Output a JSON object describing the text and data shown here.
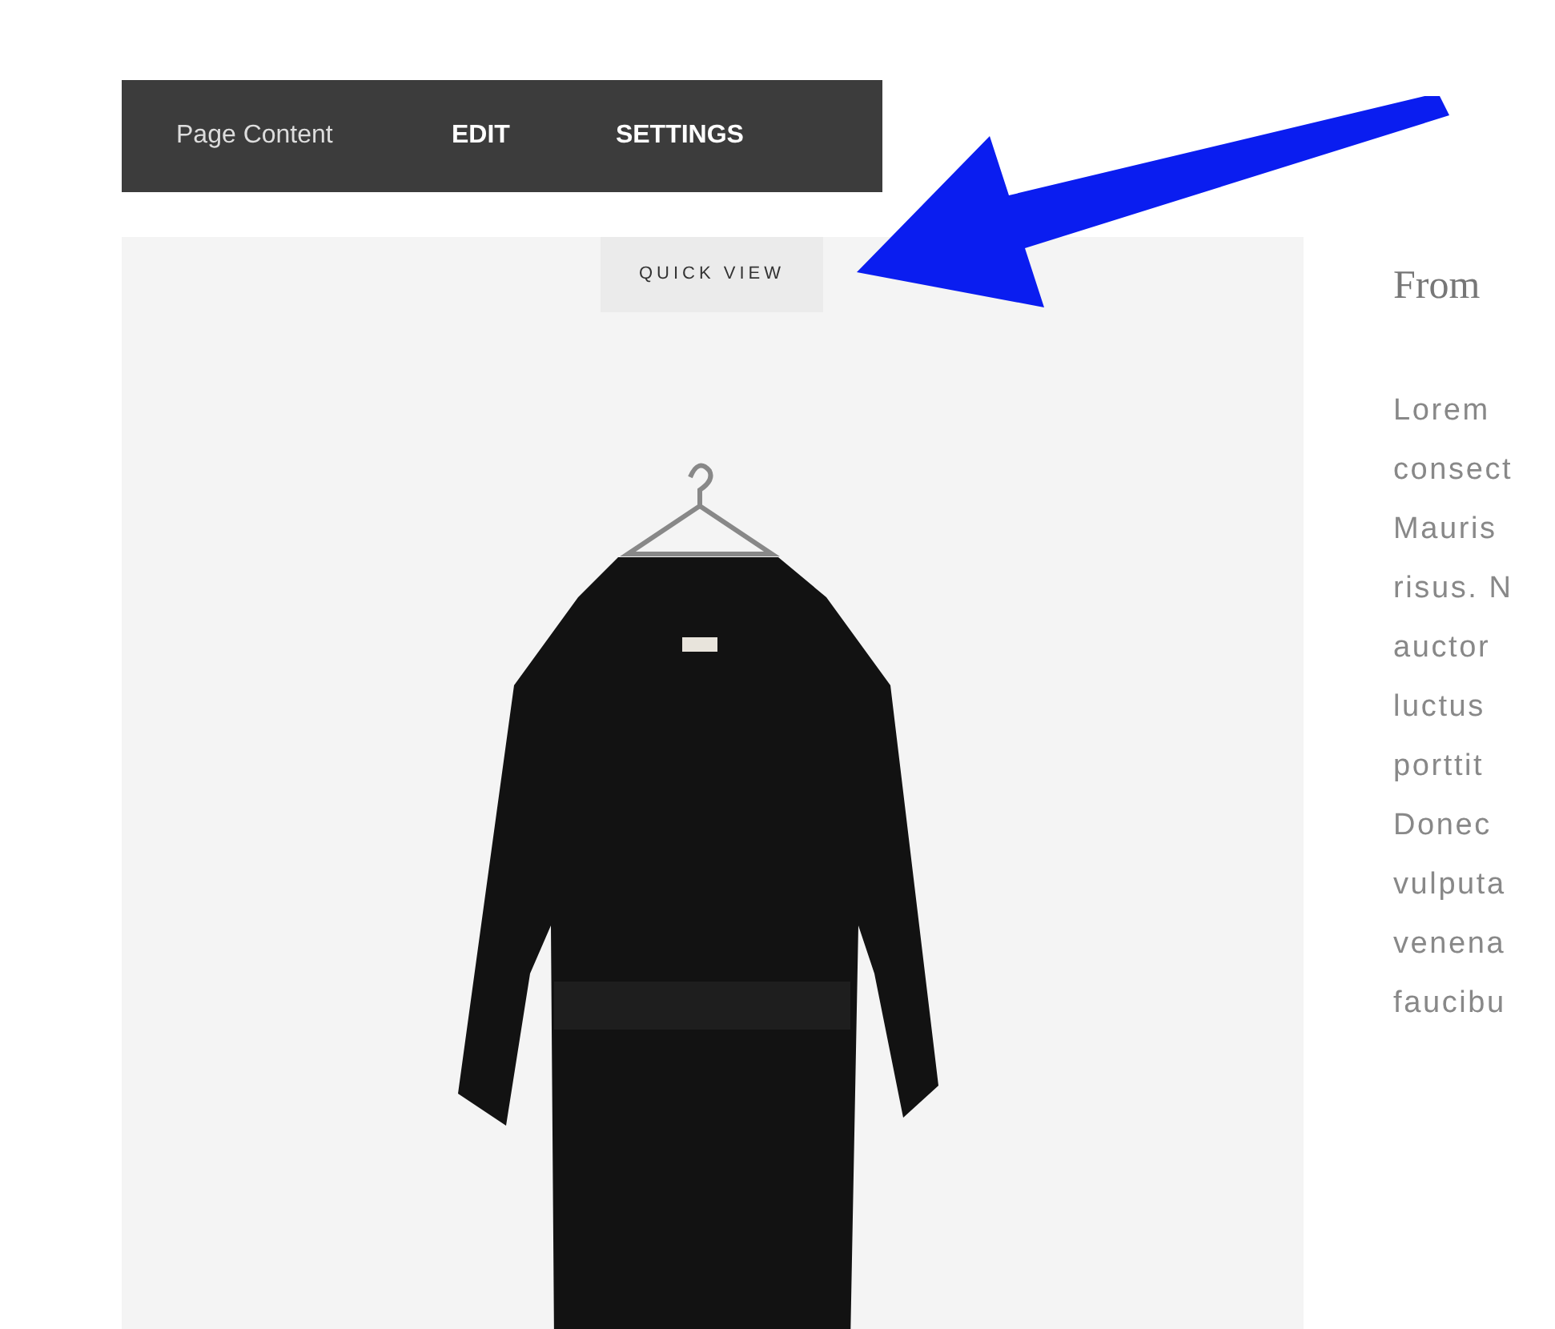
{
  "toolbar": {
    "items": [
      {
        "label": "Page Content",
        "kind": "title"
      },
      {
        "label": "EDIT",
        "kind": "action"
      },
      {
        "label": "SETTINGS",
        "kind": "action"
      }
    ]
  },
  "product": {
    "quick_view": "QUICK VIEW"
  },
  "description": {
    "heading": "From",
    "lines": [
      "Lorem",
      "consect",
      "Mauris",
      "risus. N",
      "auctor",
      "luctus",
      "porttit",
      "Donec",
      "vulputa",
      "venena",
      "faucibu"
    ]
  }
}
